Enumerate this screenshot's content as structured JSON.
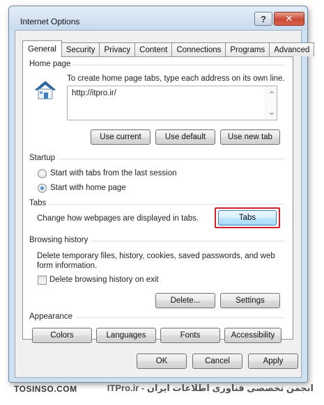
{
  "window": {
    "title": "Internet Options",
    "help_label": "?",
    "close_label": "✕"
  },
  "tabs": [
    {
      "label": "General",
      "active": true
    },
    {
      "label": "Security"
    },
    {
      "label": "Privacy"
    },
    {
      "label": "Content"
    },
    {
      "label": "Connections"
    },
    {
      "label": "Programs"
    },
    {
      "label": "Advanced"
    }
  ],
  "home_page": {
    "group_label": "Home page",
    "instruction": "To create home page tabs, type each address on its own line.",
    "url_value": "http://itpro.ir/",
    "use_current": "Use current",
    "use_default": "Use default",
    "use_new_tab": "Use new tab",
    "icon": "house-icon"
  },
  "startup": {
    "group_label": "Startup",
    "option_last_session": "Start with tabs from the last session",
    "option_home_page": "Start with home page",
    "selected": "home_page"
  },
  "tabs_section": {
    "group_label": "Tabs",
    "description": "Change how webpages are displayed in tabs.",
    "button": "Tabs",
    "highlight_color": "#d0202a"
  },
  "browsing_history": {
    "group_label": "Browsing history",
    "description_line1": "Delete temporary files, history, cookies, saved passwords, and web",
    "description_line2": "form information.",
    "delete_on_exit": "Delete browsing history on exit",
    "delete_on_exit_checked": false,
    "delete_button": "Delete...",
    "settings_button": "Settings"
  },
  "appearance": {
    "group_label": "Appearance",
    "colors": "Colors",
    "languages": "Languages",
    "fonts": "Fonts",
    "accessibility": "Accessibility"
  },
  "footer": {
    "ok": "OK",
    "cancel": "Cancel",
    "apply": "Apply"
  },
  "watermark": {
    "left": "TOSINSO.COM",
    "right": "انجمن تخصصی فناوری اطلاعات ایران - ITPro.ir"
  }
}
